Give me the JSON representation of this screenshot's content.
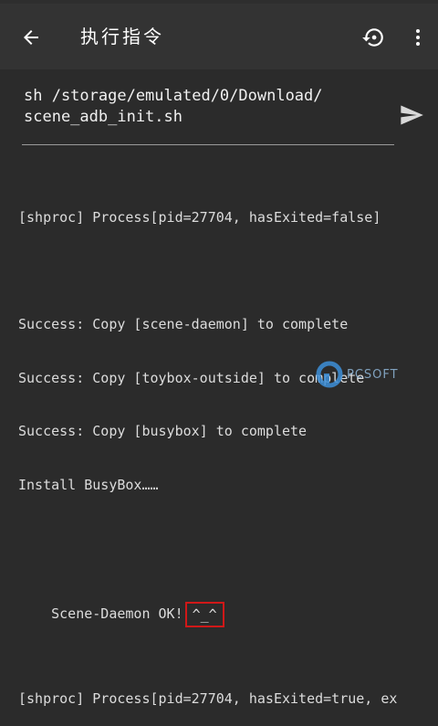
{
  "app_bar": {
    "title": "执行指令",
    "back_icon": "arrow-back-icon",
    "history_icon": "history-icon",
    "more_icon": "more-vert-icon"
  },
  "input": {
    "command": "sh /storage/emulated/0/Download/\nscene_adb_init.sh",
    "send_icon": "send-icon"
  },
  "output": {
    "lines": [
      "[shproc] Process[pid=27704, hasExited=false]",
      "",
      "Success: Copy [scene-daemon] to complete",
      "Success: Copy [toybox-outside] to complete",
      "Success: Copy [busybox] to complete",
      "Install BusyBox……",
      "",
      "Scene-Daemon OK!",
      "",
      "[shproc] Process[pid=27704, hasExited=true, ex"
    ],
    "daemon_ok_label": "Scene-Daemon OK!",
    "smiley": "^_^"
  },
  "colors": {
    "background": "#2b2b2b",
    "app_bar": "#333333",
    "highlight": "#d01818",
    "text": "#dcdcdc"
  }
}
